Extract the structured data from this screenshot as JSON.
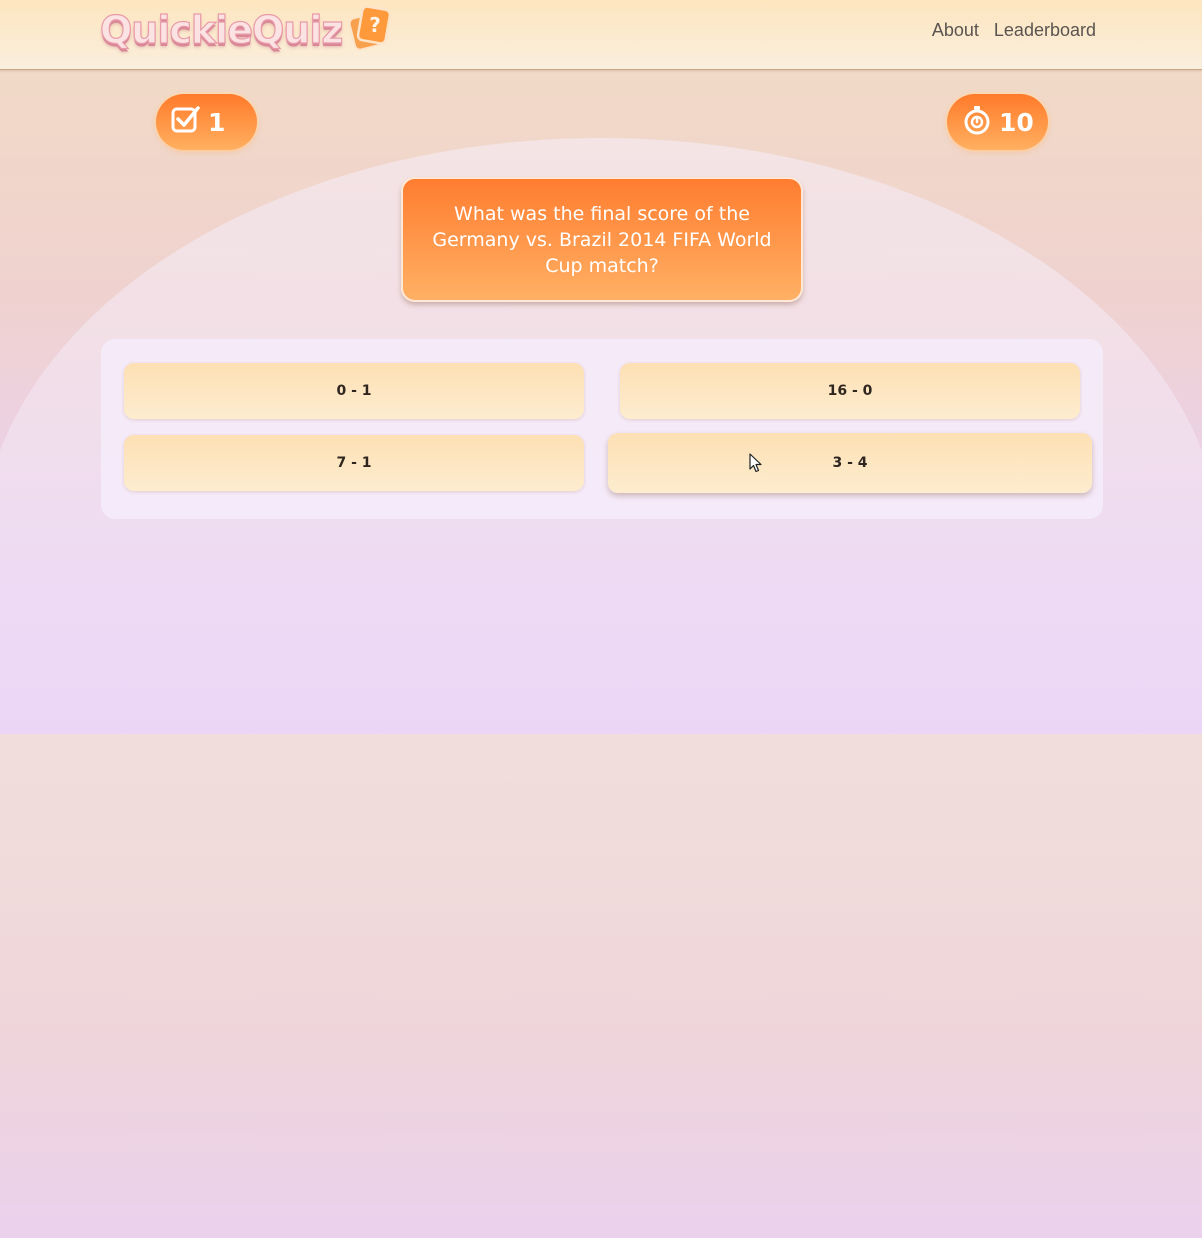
{
  "header": {
    "logo_text": "QuickieQuiz",
    "logo_card_symbol": "?",
    "nav": [
      {
        "label": "About"
      },
      {
        "label": "Leaderboard"
      }
    ]
  },
  "status": {
    "score_icon": "checkbox-check-icon",
    "score": "1",
    "timer_icon": "stopwatch-icon",
    "timer": "10"
  },
  "question": {
    "text": "What was the final score of the Germany vs. Brazil 2014 FIFA World Cup match?"
  },
  "answers": [
    {
      "label": "0 - 1"
    },
    {
      "label": "16 - 0"
    },
    {
      "label": "7 - 1"
    },
    {
      "label": "3 - 4",
      "hovered": true
    }
  ],
  "colors": {
    "accent_orange": "#ff7d30",
    "accent_light": "#ffb064",
    "answer_bg": "#fde0b4"
  }
}
